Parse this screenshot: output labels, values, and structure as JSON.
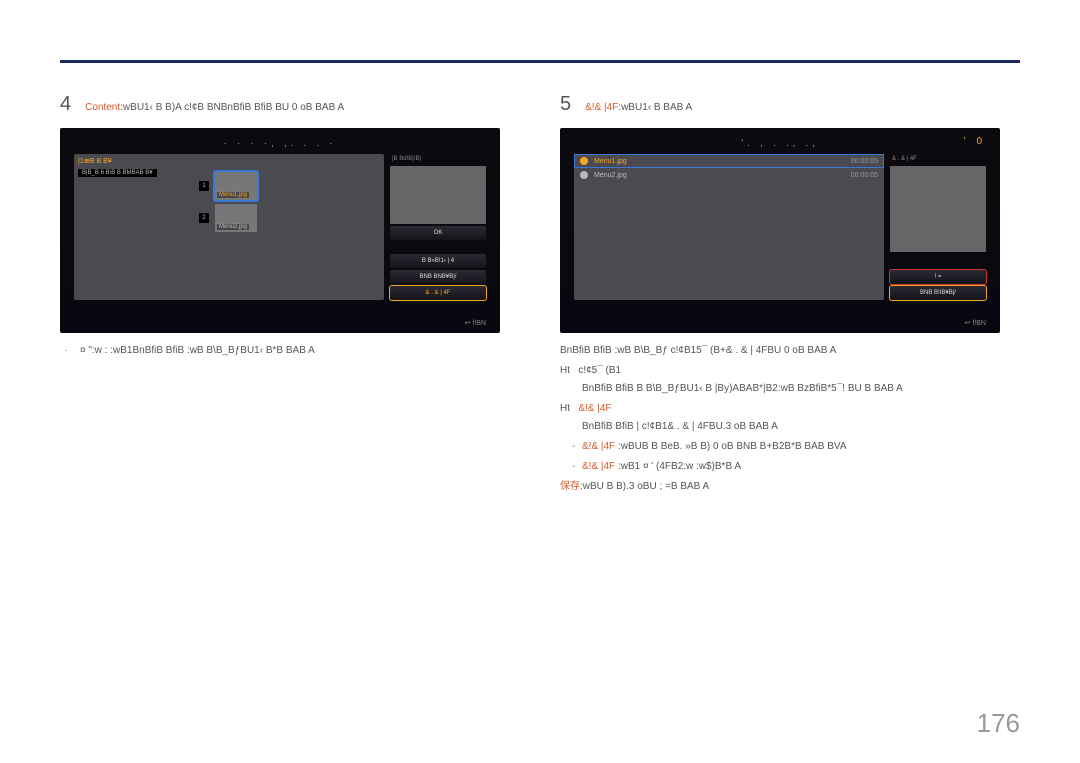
{
  "page_number": "176",
  "left": {
    "step_num": "4",
    "step_highlight": "Content",
    "step_overlay": ":wBU1‹ B B)A c!¢B BNBnBfiB BfiB BU 0 oB BAB A",
    "screen": {
      "title": "· · · ·, ,. . . ·",
      "left_pane_head": "|1æB B B¥",
      "drive": "B|B_B 6 B\\B B BMBAB B¥",
      "rp_head": "|B Bd!B|/B|",
      "thumb1_num": "1",
      "thumb1_label": "Menu1.jpg",
      "thumb2_num": "2",
      "thumb2_label": "Menu2.jpg",
      "btn_ok": "OK",
      "btn_b1": "B B»B!1‹ | 4",
      "btn_b2": "BNB BNB¥B|/",
      "btn_b3": "& . & | 4F",
      "return": "↩ f!BN"
    },
    "caption_bullet": "·",
    "caption_text": "¤ \":w : :wB1BnBfiB BfiB :wB B\\B_BƒBU1‹ B*B BAB A"
  },
  "right": {
    "step_num": "5",
    "step_highlight": "&!& |4F",
    "step_overlay": ":wBU1‹ B BAB A",
    "screen": {
      "title_center": "'. , . ., .,",
      "title_badge": "' 0",
      "rp_head": "& . & | 4F",
      "row1_label": "Menu1.jpg",
      "row1_time": "00:00:05",
      "row2_label": "Menu2.jpg",
      "row2_time": "00:00:05",
      "btn1": "! =",
      "btn2": "BNB B!IB¥B|/",
      "return": "↩ f!BN"
    },
    "para1": "BnBfiB BfiB :wB B\\B_Bƒ c!¢B15¯ (B+& . & | 4FBU 0 oB BAB A",
    "ht1_label": "Ht",
    "ht1_text": "c!¢5¯ (B1",
    "para2a": "BnBfiB BfiB B B\\B_BƒBU1‹ B |By)ABAB*|B2:wB BzBfiB*5¯! BU    B BAB A",
    "ht2_label": "Ht",
    "ht2_highlight": "&!& |4F",
    "para3": "BnBfiB BfiB | c!¢B1& . & | 4FBU.3 oB BAB A",
    "sub1_highlight": "&!& |4F",
    "sub1_text": ":wBUB B BeB. »B B) 0 oB BNB B+B2B*B BAB BVA",
    "sub2_highlight": "&!& |4F",
    "sub2_text": ":wB1 ¤ ' (4FB2:w :w$)B*B A",
    "save_highlight": "保存",
    "save_text": ":wBU  B B).3 oBU ; =B BAB A"
  }
}
